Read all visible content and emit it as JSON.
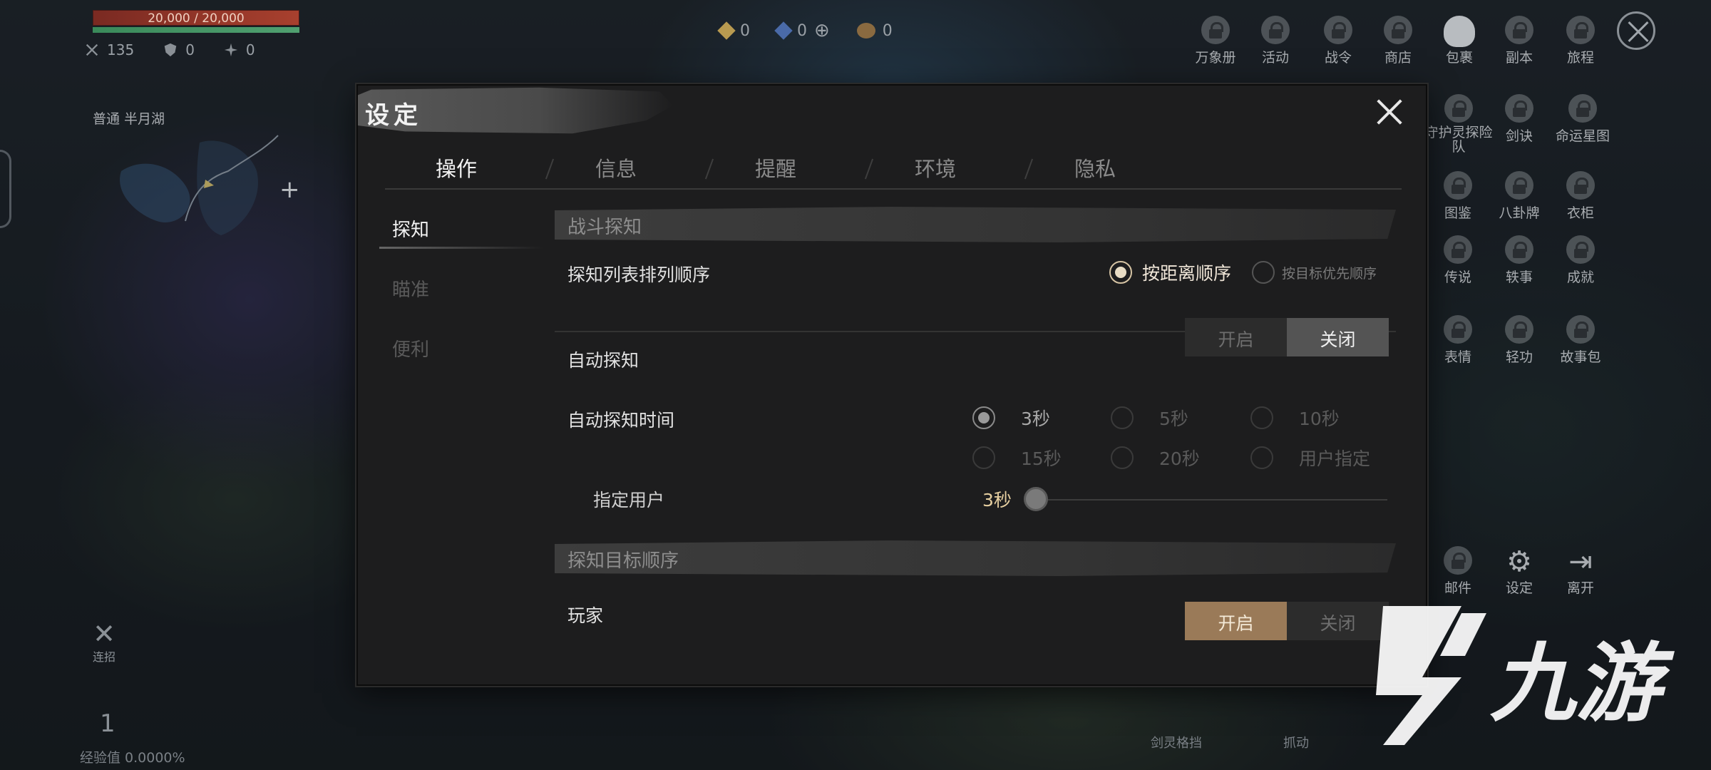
{
  "hud": {
    "hp": "20,000 / 20,000",
    "stats": [
      "135",
      "0",
      "0"
    ],
    "location": "普通  半月湖",
    "currencies": [
      "0",
      "0",
      "0"
    ],
    "menu": [
      {
        "label": "万象册",
        "icon": "lock-icon"
      },
      {
        "label": "活动",
        "icon": "lock-icon"
      },
      {
        "label": "战令",
        "icon": "lock-icon"
      },
      {
        "label": "商店",
        "icon": "lock-icon"
      },
      {
        "label": "包裹",
        "icon": "bag-icon"
      },
      {
        "label": "副本",
        "icon": "lock-icon"
      },
      {
        "label": "旅程",
        "icon": "lock-icon"
      },
      {
        "label": "守护灵探险队",
        "icon": "lock-icon"
      },
      {
        "label": "剑诀",
        "icon": "lock-icon"
      },
      {
        "label": "命运星图",
        "icon": "lock-icon"
      },
      {
        "label": "图鉴",
        "icon": "lock-icon"
      },
      {
        "label": "八卦牌",
        "icon": "lock-icon"
      },
      {
        "label": "衣柜",
        "icon": "lock-icon"
      },
      {
        "label": "传说",
        "icon": "lock-icon"
      },
      {
        "label": "轶事",
        "icon": "lock-icon"
      },
      {
        "label": "成就",
        "icon": "lock-icon"
      },
      {
        "label": "表情",
        "icon": "lock-icon"
      },
      {
        "label": "轻功",
        "icon": "lock-icon"
      },
      {
        "label": "故事包",
        "icon": "lock-icon"
      },
      {
        "label": "邮件",
        "icon": "lock-icon"
      },
      {
        "label": "设定",
        "icon": "gear-icon"
      },
      {
        "label": "离开",
        "icon": "exit-icon"
      }
    ],
    "skill_label": "连招",
    "level_num": "1",
    "exp": "经验值 0.0000%",
    "bottom_hints": [
      "剑灵格挡",
      "抓动"
    ]
  },
  "dialog": {
    "title": "设定",
    "tabs": [
      "操作",
      "信息",
      "提醒",
      "环境",
      "隐私"
    ],
    "active_tab": 0,
    "side": [
      "探知",
      "瞄准",
      "便利"
    ],
    "sections": {
      "combat_detect": "战斗探知",
      "target_order": "探知目标顺序"
    },
    "rows": {
      "sort_order": {
        "label": "探知列表排列顺序",
        "options": [
          "按距离顺序",
          "按目标优先顺序"
        ],
        "selected": 0
      },
      "auto_detect": {
        "label": "自动探知",
        "on": "开启",
        "off": "关闭",
        "selected": "off"
      },
      "auto_detect_time": {
        "label": "自动探知时间",
        "options": [
          "3秒",
          "5秒",
          "10秒",
          "15秒",
          "20秒",
          "用户指定"
        ],
        "selected": 0
      },
      "user_specified": {
        "label": "指定用户",
        "value": "3秒"
      },
      "player": {
        "label": "玩家",
        "on": "开启",
        "off": "关闭",
        "selected": "on"
      }
    }
  },
  "watermark": "九游",
  "colors": {
    "accent_gold": "#9a7a58",
    "slider_value": "#e6cfa0",
    "dialog_bg": "#1d1d1e"
  }
}
